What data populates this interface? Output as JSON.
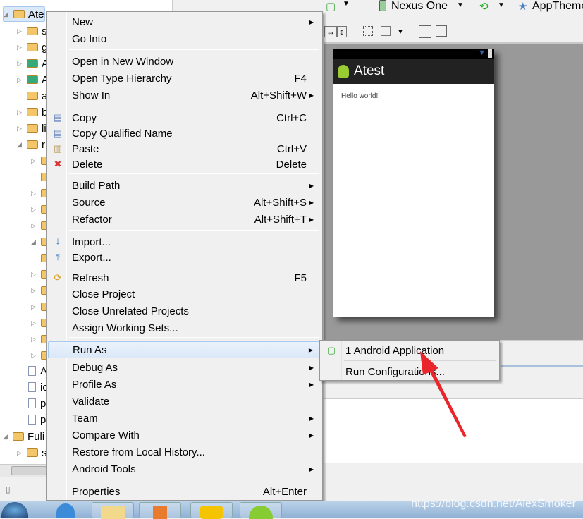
{
  "tree": {
    "items": [
      {
        "label": "Ate",
        "depth": 0,
        "tw": "◢",
        "kind": "project",
        "selected": true
      },
      {
        "label": "s",
        "depth": 1,
        "tw": "▷",
        "kind": "folder"
      },
      {
        "label": "g",
        "depth": 1,
        "tw": "▷",
        "kind": "folder"
      },
      {
        "label": "A",
        "depth": 1,
        "tw": "▷",
        "kind": "lib"
      },
      {
        "label": "A",
        "depth": 1,
        "tw": "▷",
        "kind": "lib"
      },
      {
        "label": "a",
        "depth": 1,
        "tw": "",
        "kind": "folder"
      },
      {
        "label": "b",
        "depth": 1,
        "tw": "▷",
        "kind": "folder"
      },
      {
        "label": "li",
        "depth": 1,
        "tw": "▷",
        "kind": "folder"
      },
      {
        "label": "r",
        "depth": 1,
        "tw": "◢",
        "kind": "folder"
      },
      {
        "label": "",
        "depth": 2,
        "tw": "▷",
        "kind": "folder"
      },
      {
        "label": "",
        "depth": 2,
        "tw": "",
        "kind": "folder"
      },
      {
        "label": "",
        "depth": 2,
        "tw": "▷",
        "kind": "folder"
      },
      {
        "label": "",
        "depth": 2,
        "tw": "▷",
        "kind": "folder"
      },
      {
        "label": "",
        "depth": 2,
        "tw": "▷",
        "kind": "folder"
      },
      {
        "label": "",
        "depth": 2,
        "tw": "◢",
        "kind": "folder"
      },
      {
        "label": "",
        "depth": 2,
        "tw": "",
        "kind": "folder"
      },
      {
        "label": "",
        "depth": 2,
        "tw": "▷",
        "kind": "folder"
      },
      {
        "label": "",
        "depth": 2,
        "tw": "▷",
        "kind": "folder"
      },
      {
        "label": "",
        "depth": 2,
        "tw": "▷",
        "kind": "folder"
      },
      {
        "label": "",
        "depth": 2,
        "tw": "▷",
        "kind": "folder"
      },
      {
        "label": "",
        "depth": 2,
        "tw": "▷",
        "kind": "folder"
      },
      {
        "label": "",
        "depth": 2,
        "tw": "▷",
        "kind": "folder"
      },
      {
        "label": "A",
        "depth": 1,
        "tw": "",
        "kind": "file"
      },
      {
        "label": "ic",
        "depth": 1,
        "tw": "",
        "kind": "file"
      },
      {
        "label": "p",
        "depth": 1,
        "tw": "",
        "kind": "file"
      },
      {
        "label": "p",
        "depth": 1,
        "tw": "",
        "kind": "file"
      },
      {
        "label": "Fuli",
        "depth": 0,
        "tw": "◢",
        "kind": "project"
      },
      {
        "label": "s",
        "depth": 1,
        "tw": "▷",
        "kind": "folder"
      }
    ]
  },
  "toolbar": {
    "device": "Nexus One",
    "theme": "AppTheme"
  },
  "preview": {
    "app_title": "Atest",
    "content": "Hello world!"
  },
  "context_menu": {
    "items": [
      {
        "label": "New",
        "submenu": true
      },
      {
        "label": "Go Into"
      },
      {
        "sep": true
      },
      {
        "label": "Open in New Window"
      },
      {
        "label": "Open Type Hierarchy",
        "shortcut": "F4"
      },
      {
        "label": "Show In",
        "shortcut": "Alt+Shift+W",
        "submenu": true
      },
      {
        "sep": true
      },
      {
        "label": "Copy",
        "shortcut": "Ctrl+C",
        "icon": "copy-icon"
      },
      {
        "label": "Copy Qualified Name",
        "icon": "copy-qualified-icon"
      },
      {
        "label": "Paste",
        "shortcut": "Ctrl+V",
        "icon": "paste-icon"
      },
      {
        "label": "Delete",
        "shortcut": "Delete",
        "icon": "delete-icon"
      },
      {
        "sep": true
      },
      {
        "label": "Build Path",
        "submenu": true
      },
      {
        "label": "Source",
        "shortcut": "Alt+Shift+S",
        "submenu": true
      },
      {
        "label": "Refactor",
        "shortcut": "Alt+Shift+T",
        "submenu": true
      },
      {
        "sep": true
      },
      {
        "label": "Import...",
        "icon": "import-icon"
      },
      {
        "label": "Export...",
        "icon": "export-icon"
      },
      {
        "sep": true
      },
      {
        "label": "Refresh",
        "shortcut": "F5",
        "icon": "refresh-icon"
      },
      {
        "label": "Close Project"
      },
      {
        "label": "Close Unrelated Projects"
      },
      {
        "label": "Assign Working Sets..."
      },
      {
        "sep": true
      },
      {
        "label": "Run As",
        "submenu": true,
        "highlighted": true
      },
      {
        "label": "Debug As",
        "submenu": true
      },
      {
        "label": "Profile As",
        "submenu": true
      },
      {
        "label": "Validate"
      },
      {
        "label": "Team",
        "submenu": true
      },
      {
        "label": "Compare With",
        "submenu": true
      },
      {
        "label": "Restore from Local History..."
      },
      {
        "label": "Android Tools",
        "submenu": true
      },
      {
        "sep": true
      },
      {
        "label": "Properties",
        "shortcut": "Alt+Enter"
      }
    ]
  },
  "submenu": {
    "items": [
      {
        "label": "1 Android Application",
        "icon": "android-app-icon"
      },
      {
        "label": "Run Configurations..."
      }
    ]
  },
  "annotation": {
    "arrow_color": "#e8262b"
  },
  "watermark": "https://blog.csdn.net/AlexSmoker"
}
